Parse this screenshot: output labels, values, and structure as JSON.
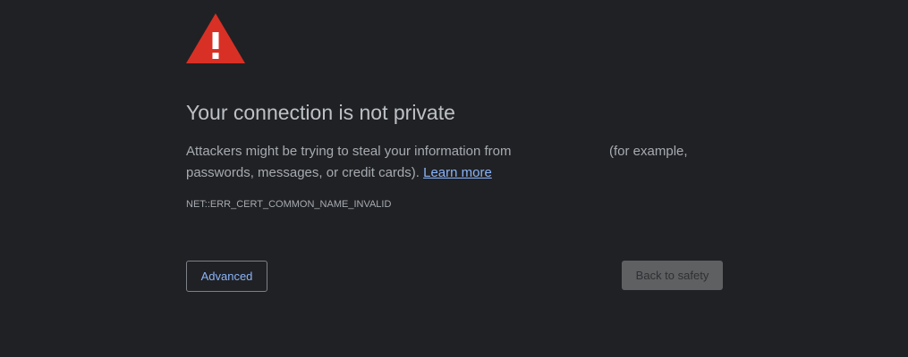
{
  "icon": "warning-triangle-icon",
  "colors": {
    "background": "#202124",
    "icon_red": "#d93025",
    "link": "#8ab4f8",
    "text": "#a6abb1",
    "title": "#bdc1c6"
  },
  "heading": "Your connection is not private",
  "description": {
    "line1": "Attackers might be trying to steal your information from",
    "example": "(for example,",
    "line2": "passwords, messages, or credit cards).",
    "learn_more": "Learn more"
  },
  "error_code": "NET::ERR_CERT_COMMON_NAME_INVALID",
  "buttons": {
    "advanced": "Advanced",
    "back_to_safety": "Back to safety"
  }
}
